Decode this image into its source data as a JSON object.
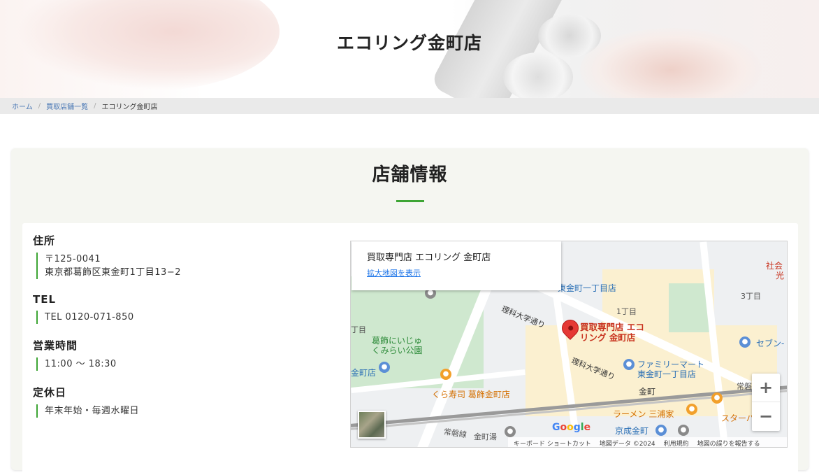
{
  "hero": {
    "title": "エコリング金町店"
  },
  "breadcrumb": {
    "home": "ホーム",
    "list": "買取店舗一覧",
    "current": "エコリング金町店",
    "separator": "/"
  },
  "section": {
    "title": "店舗情報"
  },
  "info": {
    "address_label": "住所",
    "postal": "〒125-0041",
    "address": "東京都葛飾区東金町1丁目13−2",
    "tel_label": "TEL",
    "tel": "TEL 0120-071-850",
    "hours_label": "営業時間",
    "hours": "11:00 〜 18:30",
    "holiday_label": "定休日",
    "holiday": "年末年始・毎週水曜日"
  },
  "map": {
    "info_name": "買取専門店 エコリング 金町店",
    "enlarge_link": "拡大地図を表示",
    "pin_label_1": "買取専門店 エコ",
    "pin_label_2": "リング 金町店",
    "labels": {
      "higashi_kanamachi": "東金町一丁目店",
      "chome1": "1丁目",
      "chome3": "3丁目",
      "chome_left": "丁目",
      "rika_dori_1": "理科大学通り",
      "rika_dori_2": "理科大学通り",
      "park_1": "葛飾にいじゅ",
      "park_2": "くみらい公園",
      "kanamachi_left": "金町店",
      "kura": "くら寿司 葛飾金町店",
      "familymart_1": "ファミリーマート",
      "familymart_2": "東金町一丁目店",
      "seven": "セブン-",
      "kanamachi_station": "金町",
      "joban_right": "常磐",
      "ramen": "ラーメン 三浦家",
      "starbucks": "スターバッ",
      "keisei": "京成金町",
      "joban_line": "常磐線",
      "kanamachi_yu": "金町湯",
      "shakai_1": "社会",
      "shakai_2": "光"
    },
    "google": "Google",
    "attrib": {
      "shortcuts": "キーボード ショートカット",
      "mapdata": "地図データ ©2024",
      "terms": "利用規約",
      "report": "地図の誤りを報告する"
    },
    "zoom_in": "+",
    "zoom_out": "−"
  }
}
